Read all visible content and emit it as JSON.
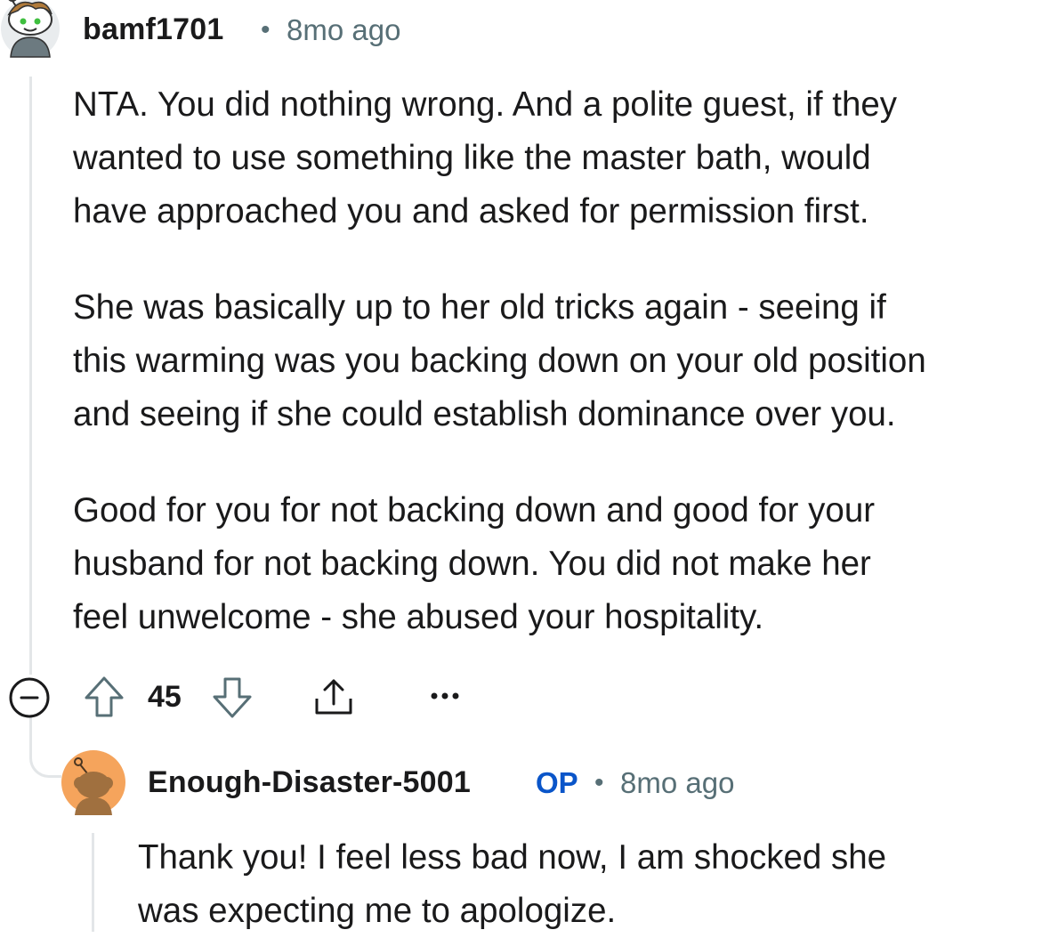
{
  "comments": [
    {
      "username": "bamf1701",
      "separator": "•",
      "timestamp": "8mo ago",
      "paragraphs": [
        [
          "NTA. You did nothing wrong. And a polite guest, if they",
          "wanted to use something like the master bath, would",
          "have approached you and asked for permission first."
        ],
        [
          "She was basically up to her old tricks again - seeing if",
          "this warming was you backing down on your old position",
          "and seeing if she could establish dominance over you."
        ],
        [
          "Good for you for not backing down and good for your",
          "husband for not backing down. You did not make her",
          "feel unwelcome - she abused your hospitality."
        ]
      ],
      "actions": {
        "vote_count": "45",
        "icons": [
          "collapse-icon",
          "upvote-icon",
          "downvote-icon",
          "share-icon",
          "more-options-icon"
        ]
      }
    },
    {
      "username": "Enough-Disaster-5001",
      "badge": "OP",
      "separator": "•",
      "timestamp": "8mo ago",
      "paragraphs": [
        [
          "Thank you! I feel less bad now, I am shocked she",
          "was expecting me to apologize."
        ]
      ]
    }
  ],
  "colors": {
    "text": "#1a1a1b",
    "meta": "#576f76",
    "op_badge": "#0a55c9",
    "thread_line": "#e3e6e8",
    "avatar2_bg": "#f5a45c"
  }
}
